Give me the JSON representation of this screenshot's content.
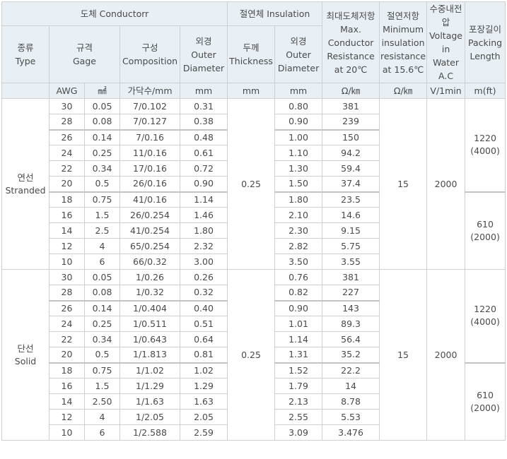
{
  "header": {
    "conductor": "도체 Conductorr",
    "insulation": "절연체 Insulation",
    "max_resistance": [
      "최대도체저항",
      "Max.",
      "Conductor",
      "Resistance",
      "at 20℃"
    ],
    "min_insulation": [
      "절연저항",
      "Minimum",
      "insulation",
      "resistance",
      "at 15.6℃"
    ],
    "voltage": [
      "수중내전",
      "압",
      "Voltage",
      "in",
      "Water",
      "A.C"
    ],
    "packing": [
      "포장길이",
      "Packing",
      "Length"
    ],
    "type": [
      "종류",
      "Type"
    ],
    "gage": [
      "규격",
      "Gage"
    ],
    "composition": [
      "구성",
      "Composition"
    ],
    "outer_diameter": [
      "외경",
      "Outer",
      "Diameter"
    ],
    "thickness": [
      "두께",
      "Thickness"
    ],
    "ins_outer_diameter": [
      "외경",
      "Outer",
      "Diameter"
    ]
  },
  "units": {
    "awg": "AWG",
    "mm2": "㎟",
    "composition": "가닥수/mm",
    "outer": "mm",
    "thickness": "mm",
    "ins_outer": "mm",
    "resistance": "Ω/㎞",
    "min_ins": "Ω/㎞",
    "voltage": "V/1min",
    "packing": "m(ft)"
  },
  "groups": [
    {
      "type": [
        "연선",
        "Stranded"
      ],
      "thickness": "0.25",
      "min_insulation": "15",
      "voltage": "2000",
      "packing": [
        [
          "1220",
          "(4000)"
        ],
        [
          "610",
          "(2000)"
        ]
      ],
      "rows": [
        {
          "awg": "30",
          "mm2": "0.05",
          "comp": "7/0.102",
          "od": "0.31",
          "ins_od": "0.80",
          "res": "381"
        },
        {
          "awg": "28",
          "mm2": "0.08",
          "comp": "7/0.127",
          "od": "0.38",
          "ins_od": "0.90",
          "res": "239"
        },
        {
          "awg": "26",
          "mm2": "0.14",
          "comp": "7/0.16",
          "od": "0.48",
          "ins_od": "1.00",
          "res": "150"
        },
        {
          "awg": "24",
          "mm2": "0.25",
          "comp": "11/0.16",
          "od": "0.61",
          "ins_od": "1.10",
          "res": "94.2"
        },
        {
          "awg": "22",
          "mm2": "0.34",
          "comp": "17/0.16",
          "od": "0.72",
          "ins_od": "1.30",
          "res": "59.4"
        },
        {
          "awg": "20",
          "mm2": "0.5",
          "comp": "26/0.16",
          "od": "0.90",
          "ins_od": "1.50",
          "res": "37.4"
        },
        {
          "awg": "18",
          "mm2": "0.75",
          "comp": "41/0.16",
          "od": "1.14",
          "ins_od": "1.80",
          "res": "23.5"
        },
        {
          "awg": "16",
          "mm2": "1.5",
          "comp": "26/0.254",
          "od": "1.46",
          "ins_od": "2.10",
          "res": "14.6"
        },
        {
          "awg": "14",
          "mm2": "2.5",
          "comp": "41/0.254",
          "od": "1.80",
          "ins_od": "2.30",
          "res": "9.15"
        },
        {
          "awg": "12",
          "mm2": "4",
          "comp": "65/0.254",
          "od": "2.32",
          "ins_od": "2.82",
          "res": "5.75"
        },
        {
          "awg": "10",
          "mm2": "6",
          "comp": "66/0.32",
          "od": "3.00",
          "ins_od": "3.50",
          "res": "3.55"
        }
      ]
    },
    {
      "type": [
        "단선",
        "Solid"
      ],
      "thickness": "0.25",
      "min_insulation": "15",
      "voltage": "2000",
      "packing": [
        [
          "1220",
          "(4000)"
        ],
        [
          "610",
          "(2000)"
        ]
      ],
      "rows": [
        {
          "awg": "30",
          "mm2": "0.05",
          "comp": "1/0.26",
          "od": "0.26",
          "ins_od": "0.76",
          "res": "381"
        },
        {
          "awg": "28",
          "mm2": "0.08",
          "comp": "1/0.32",
          "od": "0.32",
          "ins_od": "0.82",
          "res": "227"
        },
        {
          "awg": "26",
          "mm2": "0.14",
          "comp": "1/0.404",
          "od": "0.40",
          "ins_od": "0.90",
          "res": "143"
        },
        {
          "awg": "24",
          "mm2": "0.25",
          "comp": "1/0.511",
          "od": "0.51",
          "ins_od": "1.01",
          "res": "89.3"
        },
        {
          "awg": "22",
          "mm2": "0.34",
          "comp": "1/0.643",
          "od": "0.64",
          "ins_od": "1.14",
          "res": "56.4"
        },
        {
          "awg": "20",
          "mm2": "0.5",
          "comp": "1/1.813",
          "od": "0.81",
          "ins_od": "1.31",
          "res": "35.2"
        },
        {
          "awg": "18",
          "mm2": "0.75",
          "comp": "1/1.02",
          "od": "1.02",
          "ins_od": "1.52",
          "res": "22.2"
        },
        {
          "awg": "16",
          "mm2": "1.5",
          "comp": "1/1.29",
          "od": "1.29",
          "ins_od": "1.79",
          "res": "14"
        },
        {
          "awg": "14",
          "mm2": "2.50",
          "comp": "1/1.63",
          "od": "1.63",
          "ins_od": "2.13",
          "res": "8.78"
        },
        {
          "awg": "12",
          "mm2": "4",
          "comp": "1/2.05",
          "od": "2.05",
          "ins_od": "2.55",
          "res": "5.53"
        },
        {
          "awg": "10",
          "mm2": "6",
          "comp": "1/2.588",
          "od": "2.59",
          "ins_od": "3.09",
          "res": "3.476"
        }
      ]
    }
  ]
}
